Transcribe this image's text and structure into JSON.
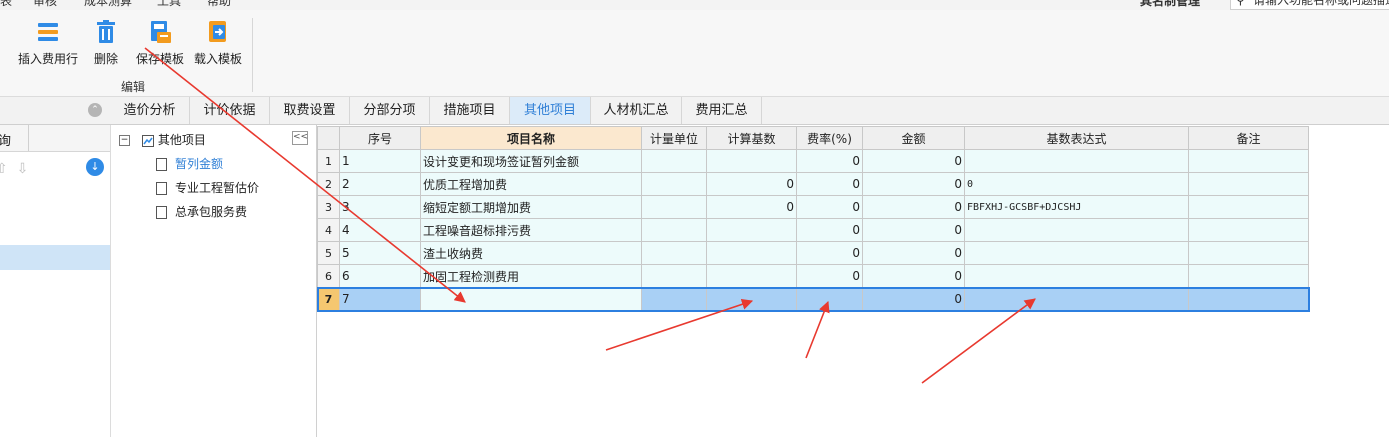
{
  "menu": {
    "items": [
      "表",
      "审核",
      "成本测算",
      "工具",
      "帮助"
    ],
    "user_label": "其名制管理",
    "search_placeholder": "请输入功能名称或问题描述"
  },
  "toolbar": {
    "buttons": [
      {
        "label": "插入费用行",
        "icon": "insert-row-icon"
      },
      {
        "label": "删除",
        "icon": "trash-icon"
      },
      {
        "label": "保存模板",
        "icon": "save-template-icon"
      },
      {
        "label": "载入模板",
        "icon": "load-template-icon"
      }
    ],
    "group_label": "编辑"
  },
  "tabs": [
    {
      "label": "造价分析",
      "active": false
    },
    {
      "label": "计价依据",
      "active": false
    },
    {
      "label": "取费设置",
      "active": false
    },
    {
      "label": "分部分项",
      "active": false
    },
    {
      "label": "措施项目",
      "active": false
    },
    {
      "label": "其他项目",
      "active": true
    },
    {
      "label": "人材机汇总",
      "active": false
    },
    {
      "label": "费用汇总",
      "active": false
    }
  ],
  "left_panel": {
    "title": "询"
  },
  "tree": {
    "root": "其他项目",
    "children": [
      {
        "label": "暂列金额",
        "selected": true
      },
      {
        "label": "专业工程暂估价",
        "selected": false
      },
      {
        "label": "总承包服务费",
        "selected": false
      }
    ]
  },
  "grid": {
    "columns": [
      "序号",
      "项目名称",
      "计量单位",
      "计算基数",
      "费率(%)",
      "金额",
      "基数表达式",
      "备注"
    ],
    "rows": [
      {
        "rn": "1",
        "seq": "1",
        "name": "设计变更和现场签证暂列金额",
        "unit": "",
        "base": "",
        "rate": "0",
        "amount": "0",
        "expr": "",
        "note": ""
      },
      {
        "rn": "2",
        "seq": "2",
        "name": "优质工程增加费",
        "unit": "",
        "base": "0",
        "rate": "0",
        "amount": "0",
        "expr": "0",
        "note": ""
      },
      {
        "rn": "3",
        "seq": "3",
        "name": "缩短定额工期增加费",
        "unit": "",
        "base": "0",
        "rate": "0",
        "amount": "0",
        "expr": "FBFXHJ-GCSBF+DJCSHJ",
        "note": ""
      },
      {
        "rn": "4",
        "seq": "4",
        "name": "工程噪音超标排污费",
        "unit": "",
        "base": "",
        "rate": "0",
        "amount": "0",
        "expr": "",
        "note": ""
      },
      {
        "rn": "5",
        "seq": "5",
        "name": "渣土收纳费",
        "unit": "",
        "base": "",
        "rate": "0",
        "amount": "0",
        "expr": "",
        "note": ""
      },
      {
        "rn": "6",
        "seq": "6",
        "name": "加固工程检测费用",
        "unit": "",
        "base": "",
        "rate": "0",
        "amount": "0",
        "expr": "",
        "note": ""
      },
      {
        "rn": "7",
        "seq": "7",
        "name": "",
        "unit": "",
        "base": "",
        "rate": "",
        "amount": "0",
        "expr": "",
        "note": ""
      }
    ]
  },
  "annotation_color": "#e8392f"
}
